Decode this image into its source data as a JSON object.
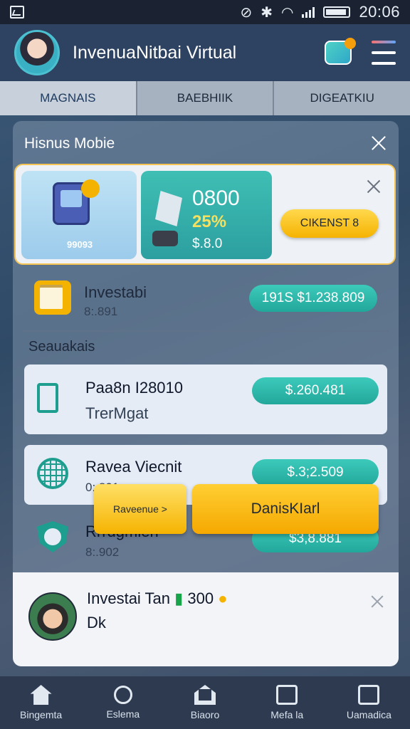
{
  "status_bar": {
    "time": "20:06"
  },
  "header": {
    "title": "InvenuaNitbai Virtual"
  },
  "tabs": [
    {
      "label": "MAGNAIS",
      "active": true
    },
    {
      "label": "BAEBHIIK",
      "active": false
    },
    {
      "label": "DIGEATKIU",
      "active": false
    }
  ],
  "modal": {
    "title": "Hisnus Mobie",
    "promo": {
      "tile1_label": "99093",
      "tile2_big": "0800",
      "tile2_pct": "25%",
      "tile2_sub": "$.8.0",
      "cta_label": "CIKENST 8"
    },
    "investment": {
      "title": "Investabi",
      "sub": "8:.891",
      "amount": "191S $1.238.809"
    },
    "section_title": "Seauakais",
    "items": [
      {
        "title": "Paa8n I28010",
        "sub": "TrerMgat",
        "amount": "$.260.481",
        "icon": "clipboard-leaf-icon"
      },
      {
        "title": "Ravea Viecnit",
        "sub": "0:.801",
        "amount": "$.3;2.509",
        "icon": "globe-grid-icon"
      },
      {
        "title": "Rrrdgmien",
        "sub": "8:.902",
        "amount": "$3,8.881",
        "icon": "shield-person-icon"
      }
    ],
    "bottom_card": {
      "title": "Investai Tan",
      "title_value": "300",
      "title2": "Dk",
      "small_button": "Raveenue >",
      "big_button": "DanisKIarl"
    }
  },
  "bottom_nav": [
    {
      "label": "Bingemta",
      "icon": "home-icon"
    },
    {
      "label": "Eslema",
      "icon": "search-icon"
    },
    {
      "label": "Biaoro",
      "icon": "building-icon"
    },
    {
      "label": "Mefa la",
      "icon": "check-box-icon"
    },
    {
      "label": "Uamadica",
      "icon": "inbox-icon"
    }
  ],
  "colors": {
    "accent_teal": "#22a79b",
    "accent_yellow": "#f5b301",
    "header_bg": "#2e4262",
    "nav_bg": "#2d3a50"
  }
}
